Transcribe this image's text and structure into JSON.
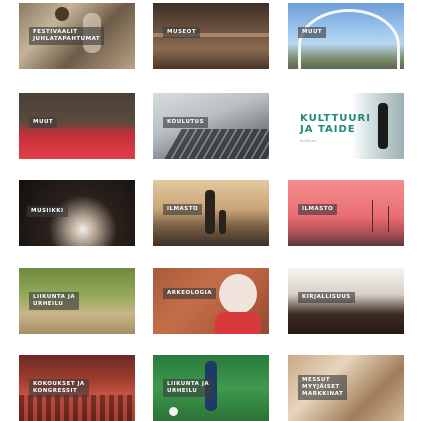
{
  "tiles": [
    {
      "id": "festivaalit",
      "label": "FESTIVAALIT\nJUHLATAPAHTUMAT"
    },
    {
      "id": "museot",
      "label": "MUSEOT"
    },
    {
      "id": "muut-1",
      "label": "MUUT"
    },
    {
      "id": "muut-2",
      "label": "MUUT"
    },
    {
      "id": "koulutus",
      "label": "KOULUTUS"
    },
    {
      "id": "kulttuuri-ja-taide",
      "label": "KULTTUURI\nJA TAIDE",
      "sublabel": "kulttuuri"
    },
    {
      "id": "musiikki",
      "label": "MUSIIKKI"
    },
    {
      "id": "ilmasto-1",
      "label": "ILMASTO"
    },
    {
      "id": "ilmasto-2",
      "label": "ILMASTO"
    },
    {
      "id": "liikunta-1",
      "label": "LIIKUNTA JA\nURHEILU"
    },
    {
      "id": "arkeologia",
      "label": "ARKEOLOGIA"
    },
    {
      "id": "kirjallisuus",
      "label": "KIRJALLISUUS"
    },
    {
      "id": "kokoukset",
      "label": "KOKOUKSET JA\nKONGRESSIT"
    },
    {
      "id": "liikunta-2",
      "label": "LIIKUNTA JA\nURHEILU"
    },
    {
      "id": "messut",
      "label": "MESSUT\nMYYJÄISET\nMARKKINAT"
    }
  ]
}
